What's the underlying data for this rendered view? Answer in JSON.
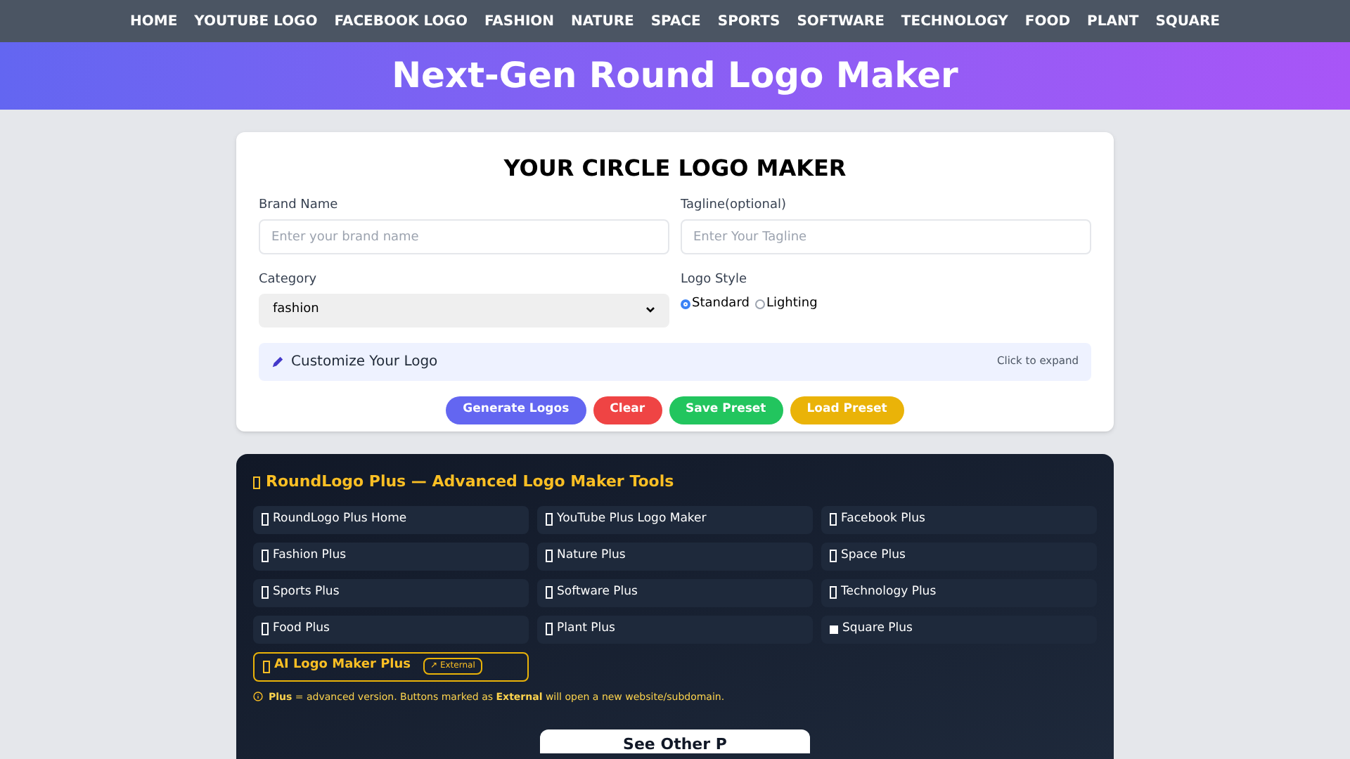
{
  "nav": [
    "HOME",
    "YOUTUBE LOGO",
    "FACEBOOK LOGO",
    "FASHION",
    "NATURE",
    "SPACE",
    "SPORTS",
    "SOFTWARE",
    "TECHNOLOGY",
    "FOOD",
    "PLANT",
    "SQUARE"
  ],
  "header": {
    "title": "Next-Gen Round Logo Maker"
  },
  "maker": {
    "title": "YOUR CIRCLE LOGO MAKER",
    "brand": {
      "label": "Brand Name",
      "placeholder": "Enter your brand name"
    },
    "tagline": {
      "label": "Tagline(optional)",
      "placeholder": "Enter Your Tagline"
    },
    "category": {
      "label": "Category",
      "value": "fashion"
    },
    "style": {
      "label": "Logo Style",
      "options": [
        {
          "label": "Standard",
          "selected": true
        },
        {
          "label": "Lighting",
          "selected": false
        }
      ]
    },
    "customize": {
      "label": "Customize Your Logo",
      "hint": "Click to expand",
      "expanded": false
    },
    "buttons": [
      {
        "label": "Generate Logos",
        "kind": "primary"
      },
      {
        "label": "Clear",
        "kind": "danger"
      },
      {
        "label": "Save Preset",
        "kind": "success"
      },
      {
        "label": "Load Preset",
        "kind": "warning"
      }
    ]
  },
  "plus": {
    "title": "RoundLogo Plus — Advanced Logo Maker Tools",
    "links": [
      {
        "label": "RoundLogo Plus Home",
        "kind": "glyph"
      },
      {
        "label": "YouTube Plus Logo Maker",
        "kind": "glyph"
      },
      {
        "label": "Facebook Plus",
        "kind": "glyph"
      },
      {
        "label": "Fashion Plus",
        "kind": "glyph"
      },
      {
        "label": "Nature Plus",
        "kind": "glyph"
      },
      {
        "label": "Space Plus",
        "kind": "glyph"
      },
      {
        "label": "Sports Plus",
        "kind": "glyph"
      },
      {
        "label": "Software Plus",
        "kind": "glyph"
      },
      {
        "label": "Technology Plus",
        "kind": "glyph"
      },
      {
        "label": "Food Plus",
        "kind": "glyph"
      },
      {
        "label": "Plant Plus",
        "kind": "glyph"
      },
      {
        "label": "Square Plus",
        "kind": "square"
      }
    ],
    "external": {
      "label": "AI Logo Maker Plus",
      "badge": "↗ External"
    },
    "note": "**Plus** = advanced version. Buttons marked as **External** will open a new website/subdomain."
  },
  "other": {
    "title": "See Other P"
  }
}
